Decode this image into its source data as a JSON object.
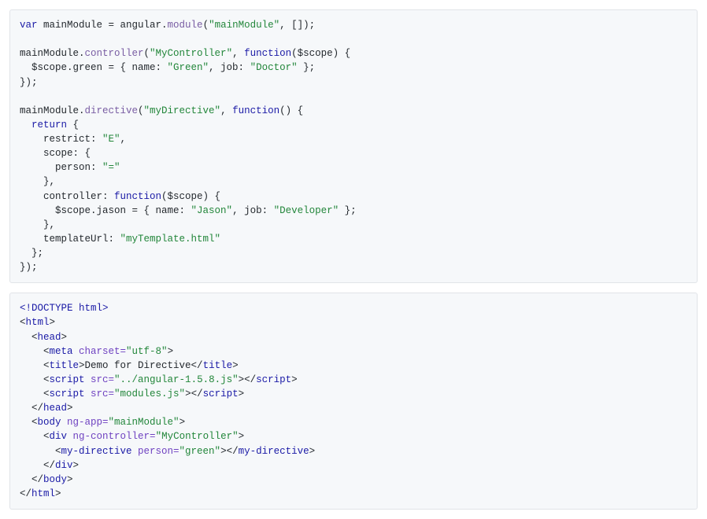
{
  "block1": {
    "l1_kw": "var",
    "l1_rest": " mainModule = angular.",
    "l1_fn": "module",
    "l1_paren": "(",
    "l1_str": "\"mainModule\"",
    "l1_tail": ", []);",
    "l2": "",
    "l3_head": "mainModule.",
    "l3_fn": "controller",
    "l3_paren": "(",
    "l3_str": "\"MyController\"",
    "l3_mid": ", ",
    "l3_kw": "function",
    "l3_args": "($scope) {",
    "l4_head": "  $scope.green = { name: ",
    "l4_s1": "\"Green\"",
    "l4_mid": ", job: ",
    "l4_s2": "\"Doctor\"",
    "l4_tail": " };",
    "l5": "});",
    "l6": "",
    "l7_head": "mainModule.",
    "l7_fn": "directive",
    "l7_paren": "(",
    "l7_str": "\"myDirective\"",
    "l7_mid": ", ",
    "l7_kw": "function",
    "l7_args": "() {",
    "l8_head": "  ",
    "l8_kw": "return",
    "l8_tail": " {",
    "l9_head": "    restrict: ",
    "l9_str": "\"E\"",
    "l9_tail": ",",
    "l10": "    scope: {",
    "l11_head": "      person: ",
    "l11_str": "\"=\"",
    "l12": "    },",
    "l13_head": "    controller: ",
    "l13_kw": "function",
    "l13_args": "($scope) {",
    "l14_head": "      $scope.jason = { name: ",
    "l14_s1": "\"Jason\"",
    "l14_mid": ", job: ",
    "l14_s2": "\"Developer\"",
    "l14_tail": " };",
    "l15": "    },",
    "l16_head": "    templateUrl: ",
    "l16_str": "\"myTemplate.html\"",
    "l17": "  };",
    "l18": "});"
  },
  "block2": {
    "l1": "<!DOCTYPE html>",
    "l2": "<",
    "l2t": "html",
    "l2e": ">",
    "l3": "  <",
    "l3t": "head",
    "l3e": ">",
    "l4": "    <",
    "l4t": "meta",
    "l4a": " charset=",
    "l4s": "\"utf-8\"",
    "l4e": ">",
    "l5": "    <",
    "l5t": "title",
    "l5m": ">Demo for Directive</",
    "l5t2": "title",
    "l5e": ">",
    "l6": "    <",
    "l6t": "script",
    "l6a": " src=",
    "l6s": "\"../angular-1.5.8.js\"",
    "l6m": "></",
    "l6t2": "script",
    "l6e": ">",
    "l7": "    <",
    "l7t": "script",
    "l7a": " src=",
    "l7s": "\"modules.js\"",
    "l7m": "></",
    "l7t2": "script",
    "l7e": ">",
    "l8": "  </",
    "l8t": "head",
    "l8e": ">",
    "l9": "  <",
    "l9t": "body",
    "l9a": " ng-app=",
    "l9s": "\"mainModule\"",
    "l9e": ">",
    "l10": "    <",
    "l10t": "div",
    "l10a": " ng-controller=",
    "l10s": "\"MyController\"",
    "l10e": ">",
    "l11": "      <",
    "l11t": "my-directive",
    "l11a": " person=",
    "l11s": "\"green\"",
    "l11m": "></",
    "l11t2": "my-directive",
    "l11e": ">",
    "l12": "    </",
    "l12t": "div",
    "l12e": ">",
    "l13": "  </",
    "l13t": "body",
    "l13e": ">",
    "l14": "</",
    "l14t": "html",
    "l14e": ">"
  }
}
